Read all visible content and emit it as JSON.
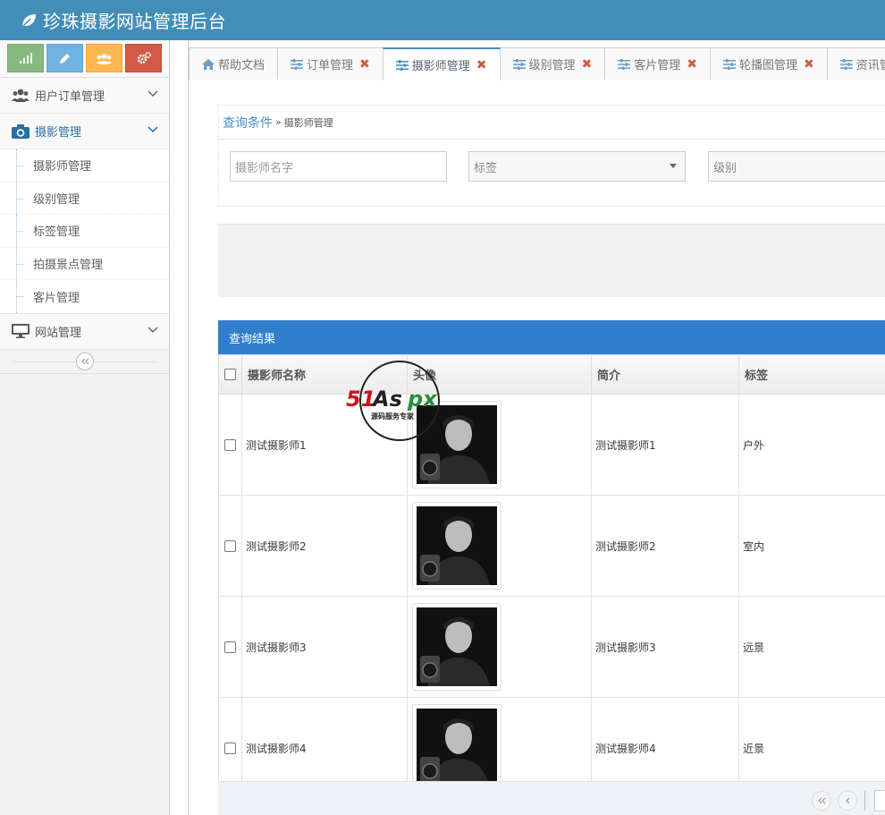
{
  "app": {
    "title": "珍珠摄影网站管理后台"
  },
  "colors": {
    "topbar": "#438eb9",
    "accent": "#307ecc",
    "close": "#d15b47"
  },
  "shortcuts": [
    {
      "name": "stats-shortcut",
      "icon": "signal-icon",
      "color": "#87b87f"
    },
    {
      "name": "edit-shortcut",
      "icon": "pencil-icon",
      "color": "#6fb3e0"
    },
    {
      "name": "users-shortcut",
      "icon": "group-icon",
      "color": "#ffb752"
    },
    {
      "name": "settings-shortcut",
      "icon": "cogs-icon",
      "color": "#d15b47"
    }
  ],
  "sidebar": {
    "menus": [
      {
        "label": "用户订单管理",
        "icon": "users-icon",
        "open": false
      },
      {
        "label": "摄影管理",
        "icon": "camera-icon",
        "open": true,
        "items": [
          "摄影师管理",
          "级别管理",
          "标签管理",
          "拍摄景点管理",
          "客片管理"
        ]
      },
      {
        "label": "网站管理",
        "icon": "desktop-icon",
        "open": false
      }
    ]
  },
  "tabs": [
    {
      "label": "帮助文档",
      "icon": "home-icon",
      "closable": false,
      "active": false
    },
    {
      "label": "订单管理",
      "icon": "sliders-icon",
      "closable": true,
      "active": false
    },
    {
      "label": "摄影师管理",
      "icon": "sliders-icon",
      "closable": true,
      "active": true
    },
    {
      "label": "级别管理",
      "icon": "sliders-icon",
      "closable": true,
      "active": false
    },
    {
      "label": "客片管理",
      "icon": "sliders-icon",
      "closable": true,
      "active": false
    },
    {
      "label": "轮播图管理",
      "icon": "sliders-icon",
      "closable": true,
      "active": false
    },
    {
      "label": "资讯管理",
      "icon": "sliders-icon",
      "closable": false,
      "active": false
    }
  ],
  "query": {
    "title": "查询条件",
    "separator": "»",
    "subtitle": "摄影师管理",
    "name_placeholder": "摄影师名字",
    "tag_placeholder": "标签",
    "level_placeholder": "级别"
  },
  "results": {
    "title": "查询结果",
    "columns": [
      "摄影师名称",
      "头像",
      "简介",
      "标签"
    ],
    "rows": [
      {
        "name": "测试摄影师1",
        "intro": "测试摄影师1",
        "tag": "户外"
      },
      {
        "name": "测试摄影师2",
        "intro": "测试摄影师2",
        "tag": "室内"
      },
      {
        "name": "测试摄影师3",
        "intro": "测试摄影师3",
        "tag": "远景"
      },
      {
        "name": "测试摄影师4",
        "intro": "测试摄影师4",
        "tag": "近景"
      }
    ]
  },
  "watermark": {
    "brand": "51Aspx",
    "slogan": "源码服务专家"
  }
}
